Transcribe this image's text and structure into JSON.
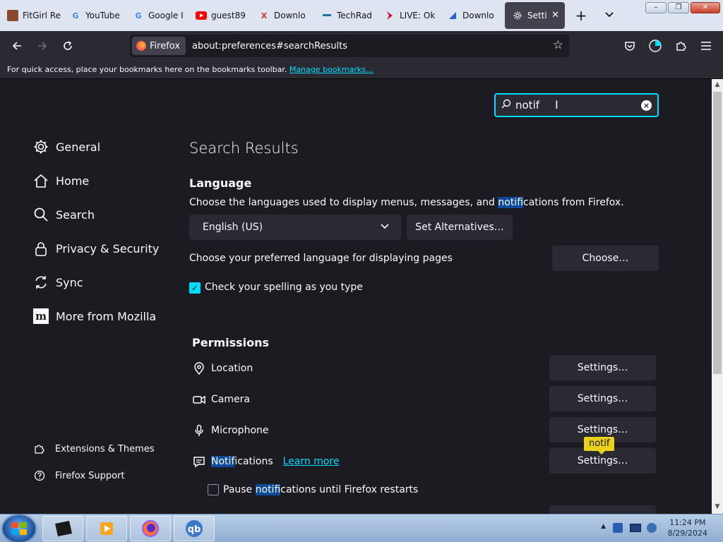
{
  "browser": {
    "tabs": [
      {
        "title": "FitGirl Re",
        "icon": "fitgirl-favicon",
        "color": "#8a4a2a"
      },
      {
        "title": "YouTube",
        "icon": "google-g-icon",
        "color": "#4285f4"
      },
      {
        "title": "Google I",
        "icon": "google-g-icon",
        "color": "#4285f4"
      },
      {
        "title": "guest89",
        "icon": "youtube-icon",
        "color": "#ff0000"
      },
      {
        "title": "Downlo",
        "icon": "x-logo-icon",
        "color": "#d0352b"
      },
      {
        "title": "TechRad",
        "icon": "techradar-icon",
        "color": "#1a6fb7"
      },
      {
        "title": "LIVE: Ok",
        "icon": "live-news-icon",
        "color": "#d1112b"
      },
      {
        "title": "Downlo",
        "icon": "download-site-icon",
        "color": "#2960d8"
      },
      {
        "title": "Setti",
        "icon": "gear-icon",
        "active": true
      }
    ],
    "identity_label": "Firefox",
    "url": "about:preferences#searchResults",
    "bookmarks_message": "For quick access, place your bookmarks here on the bookmarks toolbar.",
    "bookmarks_link": "Manage bookmarks…",
    "accent_color": "#00ddff"
  },
  "prefs": {
    "search": {
      "value": "notif"
    },
    "sidebar": {
      "general": "General",
      "home": "Home",
      "search": "Search",
      "privacy": "Privacy & Security",
      "sync": "Sync",
      "more": "More from Mozilla",
      "extensions": "Extensions & Themes",
      "support": "Firefox Support"
    },
    "page_title": "Search Results",
    "language": {
      "heading": "Language",
      "desc_before": "Choose the languages used to display menus, messages, and ",
      "desc_match": "notif",
      "desc_after": "ications from Firefox.",
      "selected": "English (US)",
      "set_alternatives": "Set Alternatives…",
      "pages_desc": "Choose your preferred language for displaying pages",
      "choose": "Choose…",
      "spellcheck": "Check your spelling as you type",
      "spellcheck_checked": true
    },
    "permissions": {
      "heading": "Permissions",
      "settings_label": "Settings…",
      "location": "Location",
      "camera": "Camera",
      "microphone": "Microphone",
      "notif_match": "Notif",
      "notif_rest": "ications",
      "learn_more": "Learn more",
      "tooltip": "notif",
      "pause_before": "Pause ",
      "pause_match": "notif",
      "pause_after": "ications until Firefox restarts",
      "pause_checked": false
    }
  },
  "taskbar": {
    "time": "11:24 PM",
    "date": "8/29/2024"
  }
}
